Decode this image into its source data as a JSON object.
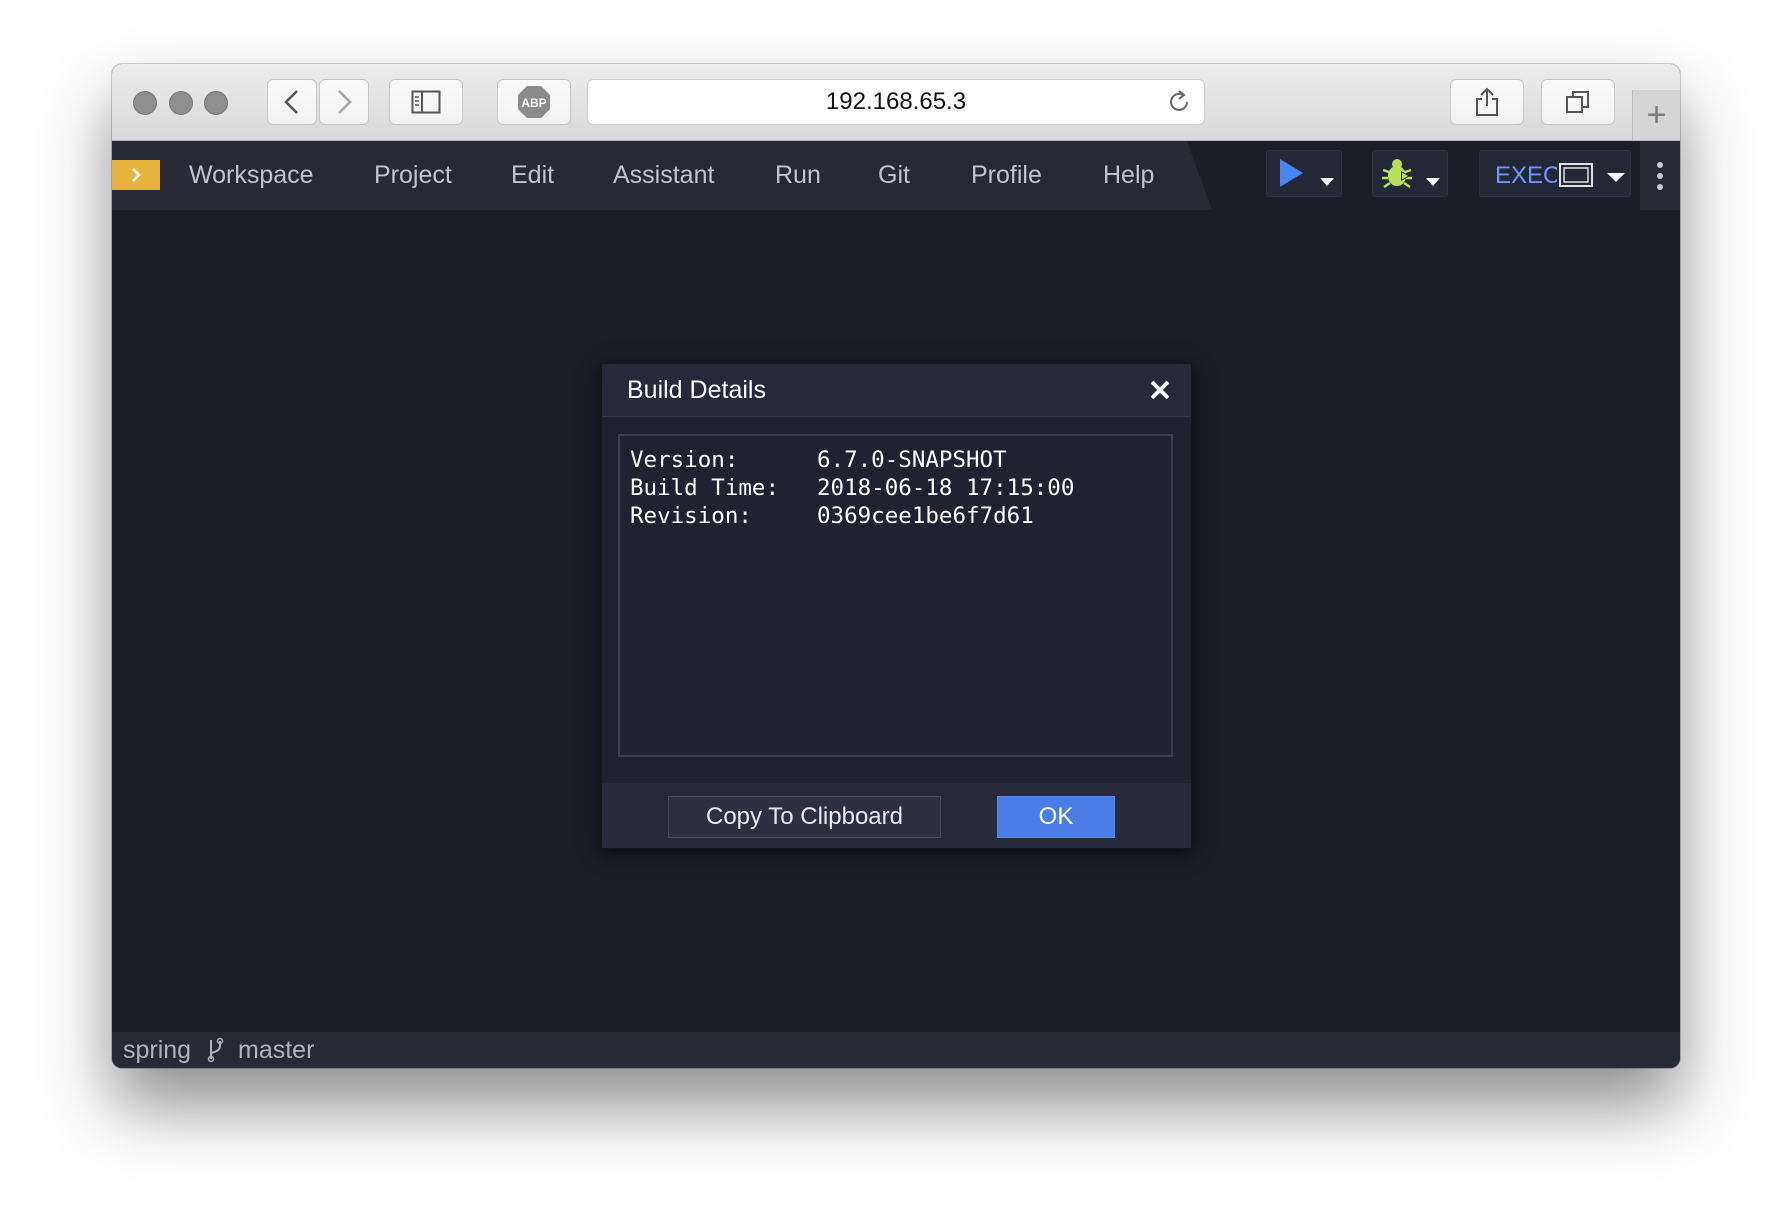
{
  "browser": {
    "url": "192.168.65.3",
    "adblock_label": "ABP",
    "new_tab_symbol": "+"
  },
  "ide": {
    "menu": [
      "Workspace",
      "Project",
      "Edit",
      "Assistant",
      "Run",
      "Git",
      "Profile",
      "Help"
    ],
    "exec_label": "EXEC",
    "accent_color": "#e6b43c",
    "run_color": "#4a85f0",
    "debug_color": "#b9e05a"
  },
  "dialog": {
    "title": "Build Details",
    "details": [
      {
        "key": "Version:",
        "value": "6.7.0-SNAPSHOT"
      },
      {
        "key": "Build Time:",
        "value": "2018-06-18 17:15:00"
      },
      {
        "key": "Revision:",
        "value": "0369cee1be6f7d61"
      }
    ],
    "copy_button": "Copy To Clipboard",
    "ok_button": "OK"
  },
  "status": {
    "project": "spring",
    "branch": "master"
  },
  "icons": [
    "back-icon",
    "forward-icon",
    "sidebar-icon",
    "reload-icon",
    "share-icon",
    "tabs-icon",
    "run-icon",
    "debug-icon",
    "monitor-icon",
    "more-icon",
    "close-icon",
    "branch-icon"
  ]
}
